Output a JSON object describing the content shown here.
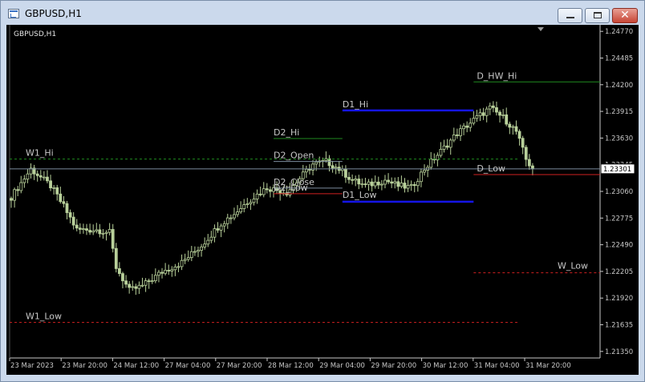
{
  "window": {
    "title": "GBPUSD,H1"
  },
  "chart": {
    "symbol_label": "GBPUSD,H1"
  },
  "colors": {
    "background": "#000000",
    "foreground": "#c8c8c8",
    "candles": "#b8d09a",
    "hi_line": "#1f8a1f",
    "low_line": "#d02020",
    "day_line": "#1515e8",
    "bid_line": "#7c8d9e",
    "price_box": "#ffffff"
  },
  "icons": {
    "app": "chart-window-icon",
    "minimize": "minimize-icon",
    "maximize": "maximize-icon",
    "close": "close-icon",
    "scroll": "chart-shift-marker-icon"
  },
  "chart_data": {
    "type": "candlestick",
    "title": "GBPUSD,H1",
    "y_ticks": [
      1.2477,
      1.24485,
      1.242,
      1.23915,
      1.2363,
      1.23345,
      1.2306,
      1.22775,
      1.2249,
      1.22205,
      1.2192,
      1.21635,
      1.2135
    ],
    "ylim": [
      1.2128,
      1.2484
    ],
    "x_ticks": [
      "23 Mar 2023",
      "23 Mar 20:00",
      "24 Mar 12:00",
      "27 Mar 04:00",
      "27 Mar 20:00",
      "28 Mar 12:00",
      "29 Mar 04:00",
      "29 Mar 20:00",
      "30 Mar 12:00",
      "31 Mar 04:00",
      "31 Mar 20:00"
    ],
    "current_price": 1.23301,
    "bars_count": 160,
    "close_anchors": [
      [
        0,
        1.23
      ],
      [
        6,
        1.233
      ],
      [
        12,
        1.2312
      ],
      [
        16,
        1.229
      ],
      [
        20,
        1.2265
      ],
      [
        26,
        1.2265
      ],
      [
        30,
        1.2262
      ],
      [
        32,
        1.2225
      ],
      [
        36,
        1.22
      ],
      [
        40,
        1.2205
      ],
      [
        46,
        1.222
      ],
      [
        52,
        1.223
      ],
      [
        58,
        1.2248
      ],
      [
        64,
        1.2272
      ],
      [
        68,
        1.2282
      ],
      [
        72,
        1.2295
      ],
      [
        78,
        1.231
      ],
      [
        84,
        1.2305
      ],
      [
        88,
        1.232
      ],
      [
        92,
        1.2335
      ],
      [
        96,
        1.2338
      ],
      [
        100,
        1.233
      ],
      [
        104,
        1.2318
      ],
      [
        108,
        1.2312
      ],
      [
        114,
        1.2318
      ],
      [
        118,
        1.2312
      ],
      [
        122,
        1.231
      ],
      [
        126,
        1.233
      ],
      [
        130,
        1.2345
      ],
      [
        136,
        1.2368
      ],
      [
        142,
        1.2385
      ],
      [
        146,
        1.2395
      ],
      [
        150,
        1.2385
      ],
      [
        154,
        1.237
      ],
      [
        157,
        1.234
      ],
      [
        159,
        1.233
      ]
    ],
    "levels": [
      {
        "name": "W1_Hi",
        "price": 1.23405,
        "x_start_bar": 0,
        "x_end_bar": 155,
        "color": "#1f8a1f",
        "style": "dashed"
      },
      {
        "name": "W1_Low",
        "price": 1.2166,
        "x_start_bar": 0,
        "x_end_bar": 155,
        "color": "#d02020",
        "style": "dashed"
      },
      {
        "name": "D2_Hi",
        "price": 1.23625,
        "x_start_bar": 80,
        "x_end_bar": 101,
        "color": "#1f8a1f",
        "style": "solid"
      },
      {
        "name": "D2_Open",
        "price": 1.2338,
        "x_start_bar": 80,
        "x_end_bar": 101,
        "color": "#7c8d9e",
        "style": "solid"
      },
      {
        "name": "D2_Close",
        "price": 1.23095,
        "x_start_bar": 80,
        "x_end_bar": 101,
        "color": "#7c8d9e",
        "style": "solid"
      },
      {
        "name": "D2_Low",
        "price": 1.23035,
        "x_start_bar": 80,
        "x_end_bar": 101,
        "color": "#d02020",
        "style": "solid"
      },
      {
        "name": "D1_Hi",
        "price": 1.23925,
        "x_start_bar": 101,
        "x_end_bar": 141,
        "color": "#1515e8",
        "style": "solid"
      },
      {
        "name": "D1_Low",
        "price": 1.2295,
        "x_start_bar": 101,
        "x_end_bar": 141,
        "color": "#1515e8",
        "style": "solid"
      },
      {
        "name": "D_HW_Hi",
        "price": 1.2423,
        "x_start_bar": 141,
        "x_end_bar": 160,
        "color": "#1f8a1f",
        "style": "solid"
      },
      {
        "name": "D_Low",
        "price": 1.2324,
        "x_start_bar": 141,
        "x_end_bar": 160,
        "color": "#d02020",
        "style": "solid"
      },
      {
        "name": "W_Low",
        "price": 1.2219,
        "x_start_bar": 141,
        "x_end_bar": 160,
        "color": "#d02020",
        "style": "dashed"
      }
    ]
  }
}
